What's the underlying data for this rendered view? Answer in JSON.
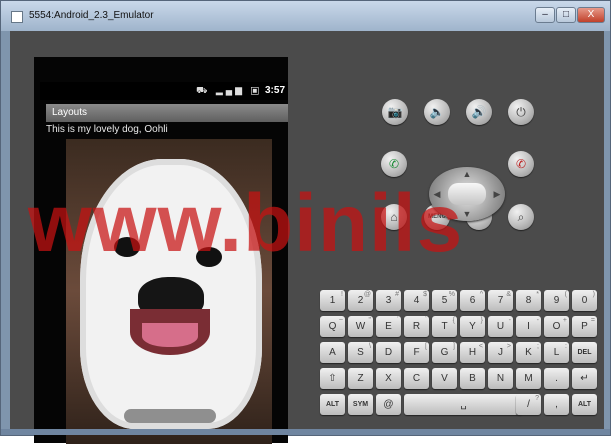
{
  "window": {
    "title": "5554:Android_2.3_Emulator",
    "controls": {
      "minimize": "–",
      "maximize": "□",
      "close": "X"
    }
  },
  "status_bar": {
    "icons": "⛟ ▂▄▆ ▣",
    "time": "3:57"
  },
  "app_bar": {
    "title": "Layouts"
  },
  "content": {
    "caption": "This is my lovely dog, Oohli"
  },
  "controls": {
    "camera": "📷",
    "vol_down": "🔈",
    "vol_up": "🔊",
    "power": "⏻",
    "call": "✆",
    "end": "✆",
    "home": "⌂",
    "menu": "MENU",
    "back": "↶",
    "search": "⌕",
    "dpad": {
      "up": "▲",
      "down": "▼",
      "left": "◀",
      "right": "▶"
    }
  },
  "keyboard": {
    "row1": [
      {
        "main": "1",
        "sub": "!"
      },
      {
        "main": "2",
        "sub": "@"
      },
      {
        "main": "3",
        "sub": "#"
      },
      {
        "main": "4",
        "sub": "$"
      },
      {
        "main": "5",
        "sub": "%"
      },
      {
        "main": "6",
        "sub": "^"
      },
      {
        "main": "7",
        "sub": "&"
      },
      {
        "main": "8",
        "sub": "*"
      },
      {
        "main": "9",
        "sub": "("
      },
      {
        "main": "0",
        "sub": ")"
      }
    ],
    "row2": [
      {
        "main": "Q",
        "sub": "~"
      },
      {
        "main": "W",
        "sub": "\""
      },
      {
        "main": "E",
        "sub": "´"
      },
      {
        "main": "R",
        "sub": "`"
      },
      {
        "main": "T",
        "sub": "{"
      },
      {
        "main": "Y",
        "sub": "}"
      },
      {
        "main": "U",
        "sub": "-"
      },
      {
        "main": "I",
        "sub": "-"
      },
      {
        "main": "O",
        "sub": "+"
      },
      {
        "main": "P",
        "sub": "="
      }
    ],
    "row3": [
      {
        "main": "A",
        "sub": ""
      },
      {
        "main": "S",
        "sub": "\\"
      },
      {
        "main": "D",
        "sub": ""
      },
      {
        "main": "F",
        "sub": "["
      },
      {
        "main": "G",
        "sub": "]"
      },
      {
        "main": "H",
        "sub": "<"
      },
      {
        "main": "J",
        "sub": ">"
      },
      {
        "main": "K",
        "sub": ";"
      },
      {
        "main": "L",
        "sub": ":"
      },
      {
        "main": "DEL",
        "sub": ""
      }
    ],
    "row4": [
      {
        "main": "⇧",
        "sub": ""
      },
      {
        "main": "Z",
        "sub": ""
      },
      {
        "main": "X",
        "sub": ""
      },
      {
        "main": "C",
        "sub": ""
      },
      {
        "main": "V",
        "sub": ""
      },
      {
        "main": "B",
        "sub": ""
      },
      {
        "main": "N",
        "sub": ""
      },
      {
        "main": "M",
        "sub": ""
      },
      {
        "main": ".",
        "sub": ""
      },
      {
        "main": "↵",
        "sub": ""
      }
    ],
    "row5": [
      {
        "main": "ALT",
        "sub": ""
      },
      {
        "main": "SYM",
        "sub": ""
      },
      {
        "main": "@",
        "sub": ""
      },
      {
        "main": "␣",
        "sub": ""
      },
      {
        "main": "/",
        "sub": "?"
      },
      {
        "main": ",",
        "sub": ""
      },
      {
        "main": "ALT",
        "sub": ""
      }
    ]
  },
  "watermark": {
    "text": "www.binils"
  },
  "colors": {
    "watermark": "#c81212",
    "chrome": "#7f95ad",
    "panel": "#4b4b4b"
  }
}
